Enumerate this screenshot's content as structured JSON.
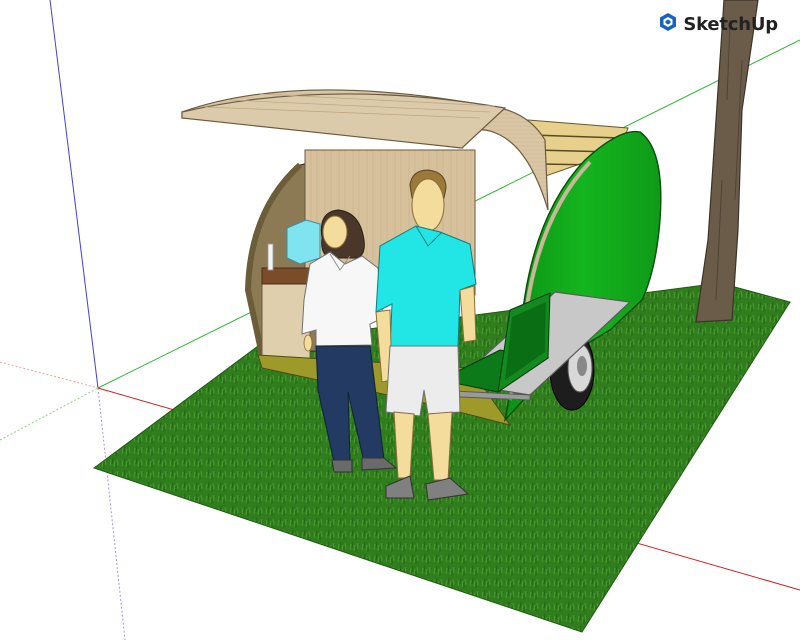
{
  "app": {
    "brand_name": "SketchUp",
    "brand_icon": "sketchup-logo-icon",
    "brand_color": "#1565c0"
  },
  "scene": {
    "objects": [
      "teardrop-trailer",
      "woman-figure",
      "man-figure",
      "tree-trunk",
      "grass-ground-plane",
      "laptop",
      "fold-down-table"
    ],
    "colors": {
      "grass": "#2f7d1c",
      "trailer_side": "#11a51b",
      "wood": "#d8c4a2",
      "shirt_man": "#22e6e6",
      "tree": "#6b5c4a"
    }
  }
}
